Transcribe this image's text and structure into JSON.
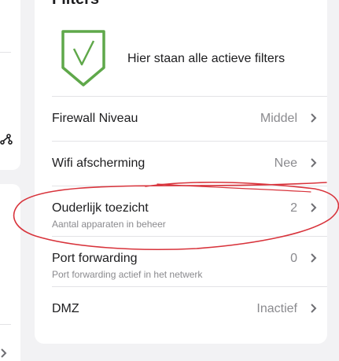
{
  "filters": {
    "title": "Filters",
    "summary": "Hier staan alle actieve filters",
    "rows": [
      {
        "label": "Firewall Niveau",
        "sublabel": "",
        "value": "Middel"
      },
      {
        "label": "Wifi afscherming",
        "sublabel": "",
        "value": "Nee"
      },
      {
        "label": "Ouderlijk toezicht",
        "sublabel": "Aantal apparaten in beheer",
        "value": "2"
      },
      {
        "label": "Port forwarding",
        "sublabel": "Port forwarding actief in het netwerk",
        "value": "0"
      },
      {
        "label": "DMZ",
        "sublabel": "",
        "value": "Inactief"
      }
    ]
  },
  "colors": {
    "shield_green": "#5fa84a",
    "annotation_red": "#d8333b",
    "background": "#f2f2f4"
  },
  "icons": {
    "shield": "shield-check-icon",
    "chevron": "chevron-right-icon",
    "partial_left": "network-nodes-icon"
  }
}
